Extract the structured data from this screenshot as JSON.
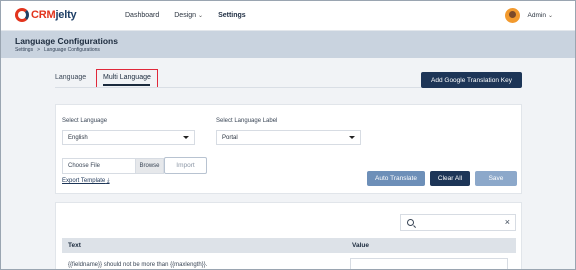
{
  "app": {
    "logo_text_a": "CRM",
    "logo_text_b": "jelty"
  },
  "nav": {
    "items": [
      {
        "label": "Dashboard",
        "active": false,
        "has_chevron": false
      },
      {
        "label": "Design",
        "active": false,
        "has_chevron": true
      },
      {
        "label": "Settings",
        "active": true,
        "has_chevron": false
      }
    ]
  },
  "user": {
    "name": "Admin"
  },
  "header": {
    "title": "Language Configurations",
    "breadcrumb": [
      "Settings",
      ">",
      "Language Configurations"
    ]
  },
  "tabs": [
    {
      "label": "Language",
      "active": false
    },
    {
      "label": "Multi Language",
      "active": true
    }
  ],
  "toolbar": {
    "google_key_label": "Add Google Translation Key"
  },
  "form": {
    "select_language_label": "Select Language",
    "select_language_value": "English",
    "select_label_label": "Select Language Label",
    "select_label_value": "Portal",
    "file_placeholder": "Choose File",
    "browse_label": "Browse",
    "import_label": "Import",
    "export_label": "Export Template",
    "export_icon": "download-icon",
    "auto_translate_label": "Auto Translate",
    "clear_all_label": "Clear All",
    "save_label": "Save"
  },
  "table": {
    "search_value": "",
    "columns": [
      "Text",
      "Value"
    ],
    "rows": [
      {
        "text": "{{fieldname}} should not be more than {{maxlength}}.",
        "value": ""
      }
    ]
  },
  "colors": {
    "primary": "#1d3557",
    "accent_red": "#e2341d",
    "header_band": "#c9d3df",
    "highlight_box": "#e0283a"
  }
}
